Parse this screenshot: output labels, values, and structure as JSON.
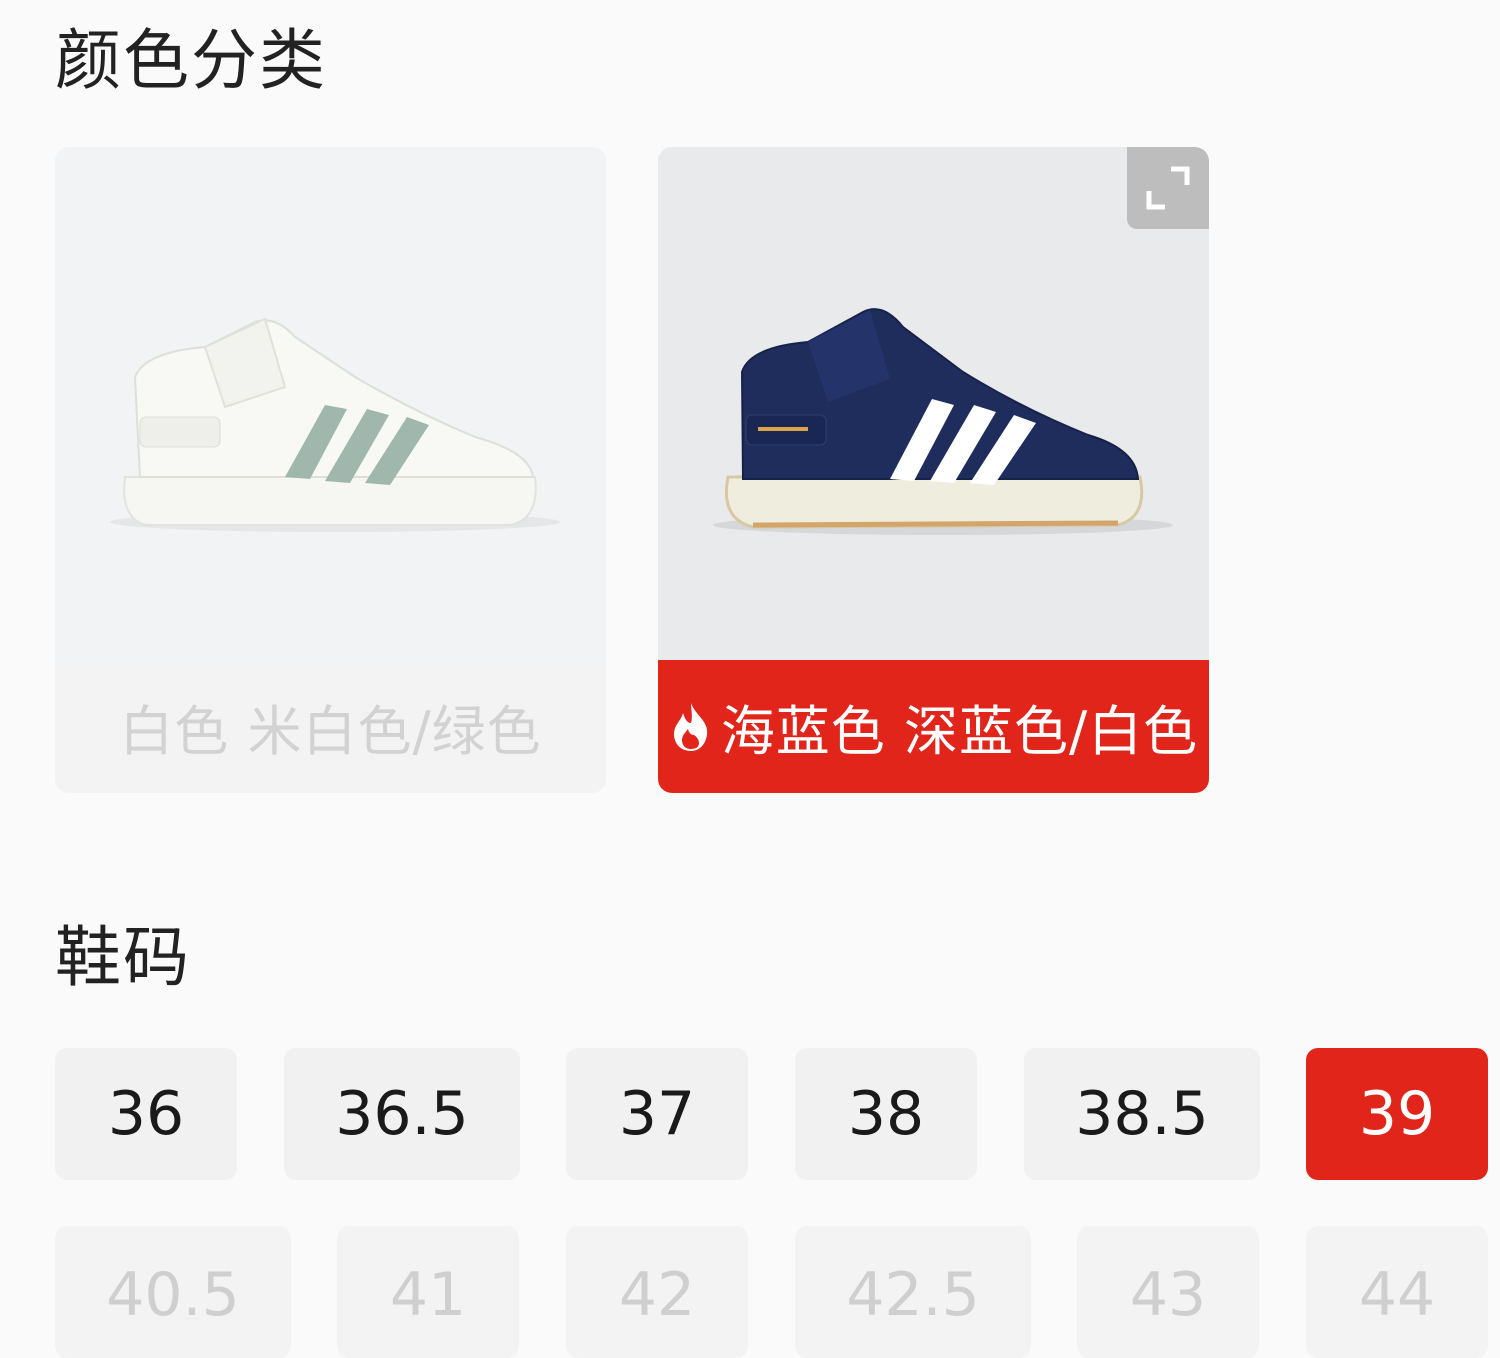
{
  "sections": {
    "color_title": "颜色分类",
    "size_title": "鞋码"
  },
  "colors": [
    {
      "label": "白色 米白色/绿色",
      "selected": false,
      "hot": false
    },
    {
      "label": "海蓝色 深蓝色/白色",
      "selected": true,
      "hot": true
    }
  ],
  "sizes_row1": [
    "36",
    "36.5",
    "37",
    "38",
    "38.5",
    "39"
  ],
  "sizes_row2": [
    "40.5",
    "41",
    "42",
    "42.5",
    "43",
    "44"
  ],
  "selected_size": "39",
  "accent_color": "#e1251b",
  "icons": {
    "hot": "flame-icon",
    "expand": "expand-icon"
  }
}
